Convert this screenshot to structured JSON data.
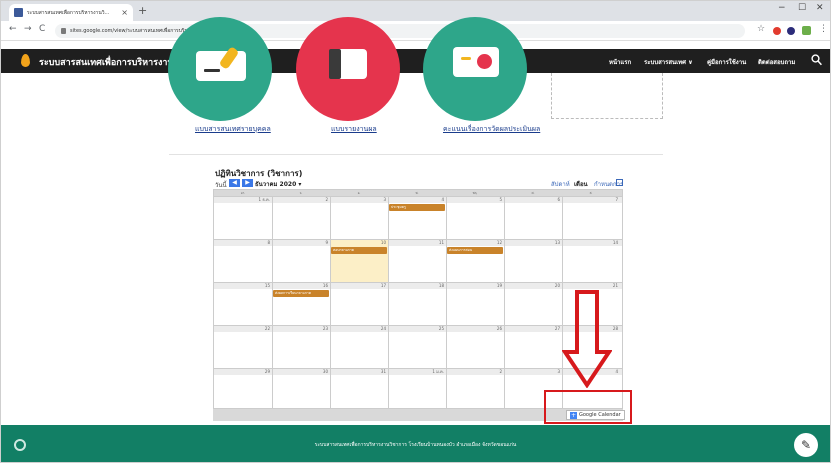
{
  "browser": {
    "tab_title": "ระบบสารสนเทศเพื่อการบริหารงานวิ...",
    "url": "sites.google.com/view/ระบบสารสนเทศเพื่อการบริหารงานวิชาการ/ปฏิทินวิชาการ",
    "icons": {
      "tab_close": "×",
      "new_tab": "+",
      "minimize": "−",
      "maximize": "☐",
      "close": "✕",
      "back": "←",
      "forward": "→",
      "reload": "C",
      "star": "☆",
      "menu": "⋮"
    }
  },
  "site": {
    "title": "ระบบสารสนเทศเพื่อการบริหารงานวิชาการ",
    "nav": [
      "หน้าแรก",
      "ระบบสารสนเทศ ∨",
      "คู่มือการใช้งาน",
      "ติดต่อสอบถาม"
    ]
  },
  "hero": {
    "links": [
      "แบบสารสนเทศรายบุคคล",
      "แบบรายงานผล",
      "คะแนนเรื่องการวัดผลประเมินผล"
    ]
  },
  "calendar": {
    "title": "ปฏิทินวิชาการ (วิชาการ)",
    "today_label": "วันนี้",
    "prev": "◀",
    "next": "▶",
    "month_label": "ธันวาคม 2020 ▾",
    "views": [
      "สัปดาห์",
      "เดือน",
      "กำหนดการ"
    ],
    "active_view": "เดือน",
    "day_headers": [
      "อา.",
      "จ.",
      "อ.",
      "พ.",
      "พฤ.",
      "ศ.",
      "ส."
    ],
    "weeks": [
      {
        "days": [
          "1 ธ.ค.",
          "2",
          "3",
          "4",
          "5",
          "6",
          "7"
        ],
        "events": [
          {
            "day": 3,
            "label": "ประชุมครู"
          }
        ]
      },
      {
        "days": [
          "8",
          "9",
          "10",
          "11",
          "12",
          "13",
          "14"
        ],
        "highlight_day": 2,
        "events": [
          {
            "day": 2,
            "label": "สอบกลางภาค"
          },
          {
            "day": 4,
            "label": "ส่งแผนการสอน"
          }
        ]
      },
      {
        "days": [
          "15",
          "16",
          "17",
          "18",
          "19",
          "20",
          "21"
        ],
        "events": [
          {
            "day": 1,
            "label": "ส่งผลการเรียนกลางภาค"
          }
        ]
      },
      {
        "days": [
          "22",
          "23",
          "24",
          "25",
          "26",
          "27",
          "28"
        ],
        "events": []
      },
      {
        "days": [
          "29",
          "30",
          "31",
          "1 ม.ค.",
          "2",
          "3",
          "4"
        ],
        "events": []
      }
    ],
    "footer_badge": "Google Calendar",
    "footer_badge_icon": "+"
  },
  "footer": {
    "text": "ระบบสารสนเทศเพื่อการบริหารงานวิชาการ โรงเรียนบ้านหนองบัว อำเภอเมือง จังหวัดขอนแก่น",
    "edit_icon": "✎"
  },
  "annotation": {
    "color": "#d7191c"
  }
}
